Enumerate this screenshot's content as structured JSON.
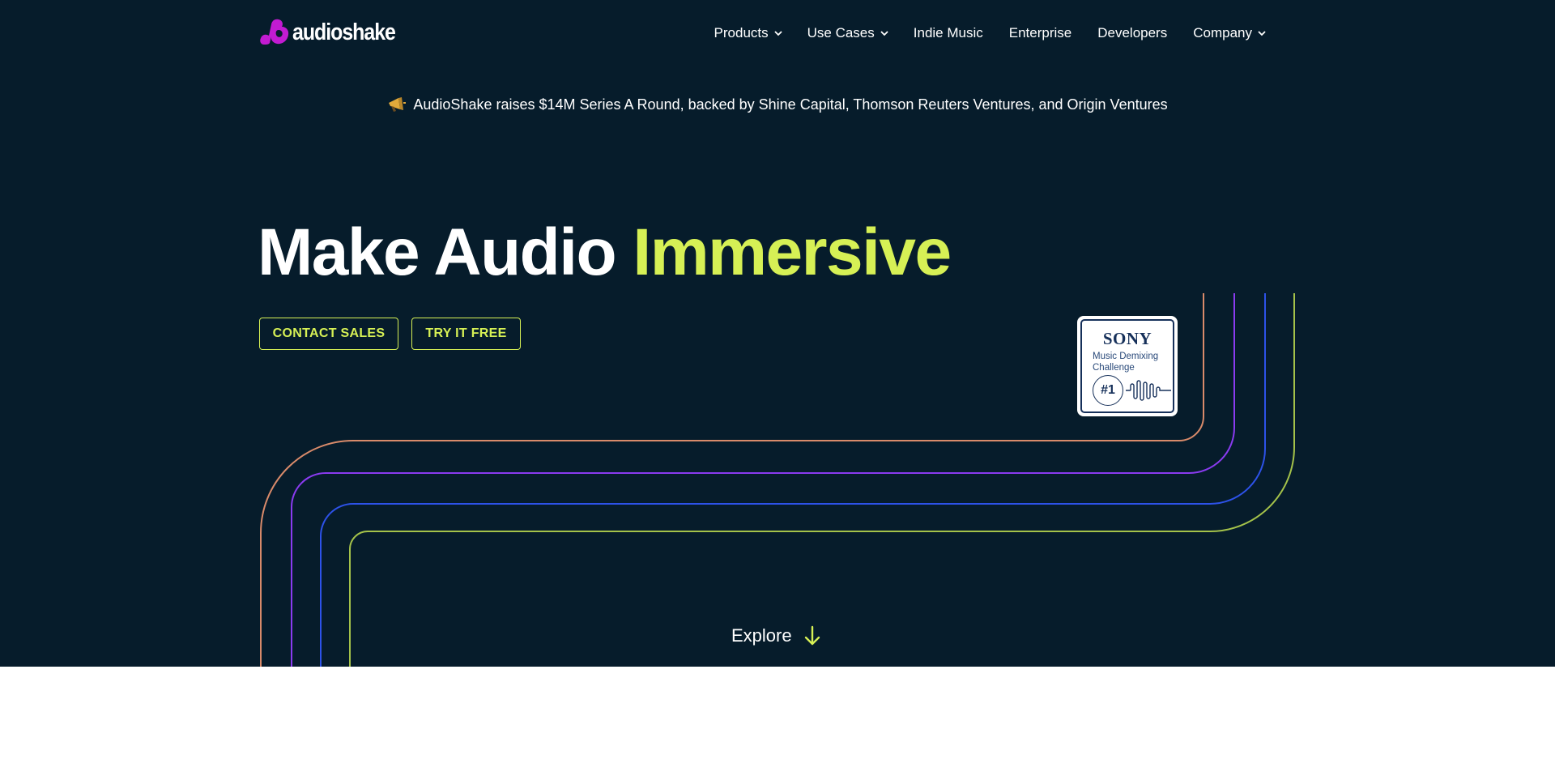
{
  "brand": {
    "name": "audioshake",
    "logo_color": "#c21bd1"
  },
  "nav": {
    "items": [
      {
        "label": "Products",
        "has_menu": true
      },
      {
        "label": "Use Cases",
        "has_menu": true
      },
      {
        "label": "Indie Music",
        "has_menu": false
      },
      {
        "label": "Enterprise",
        "has_menu": false
      },
      {
        "label": "Developers",
        "has_menu": false
      },
      {
        "label": "Company",
        "has_menu": true
      }
    ]
  },
  "announcement": {
    "icon": "megaphone-icon",
    "text": "AudioShake raises $14M Series A Round, backed by Shine Capital, Thomson Reuters Ventures, and Origin Ventures"
  },
  "hero": {
    "headline_plain": "Make Audio ",
    "headline_accent": "Immersive",
    "accent_color": "#d6f055",
    "background": "#061c2b",
    "buttons": {
      "contact": "CONTACT SALES",
      "try": "TRY IT FREE"
    },
    "explore": "Explore"
  },
  "badge": {
    "brand": "SONY",
    "subtitle_line1": "Music Demixing",
    "subtitle_line2": "Challenge",
    "rank": "#1"
  },
  "decor_lines": {
    "colors": [
      "#d88a6a",
      "#8a3bf0",
      "#2d52e8",
      "#a4c24a"
    ]
  }
}
